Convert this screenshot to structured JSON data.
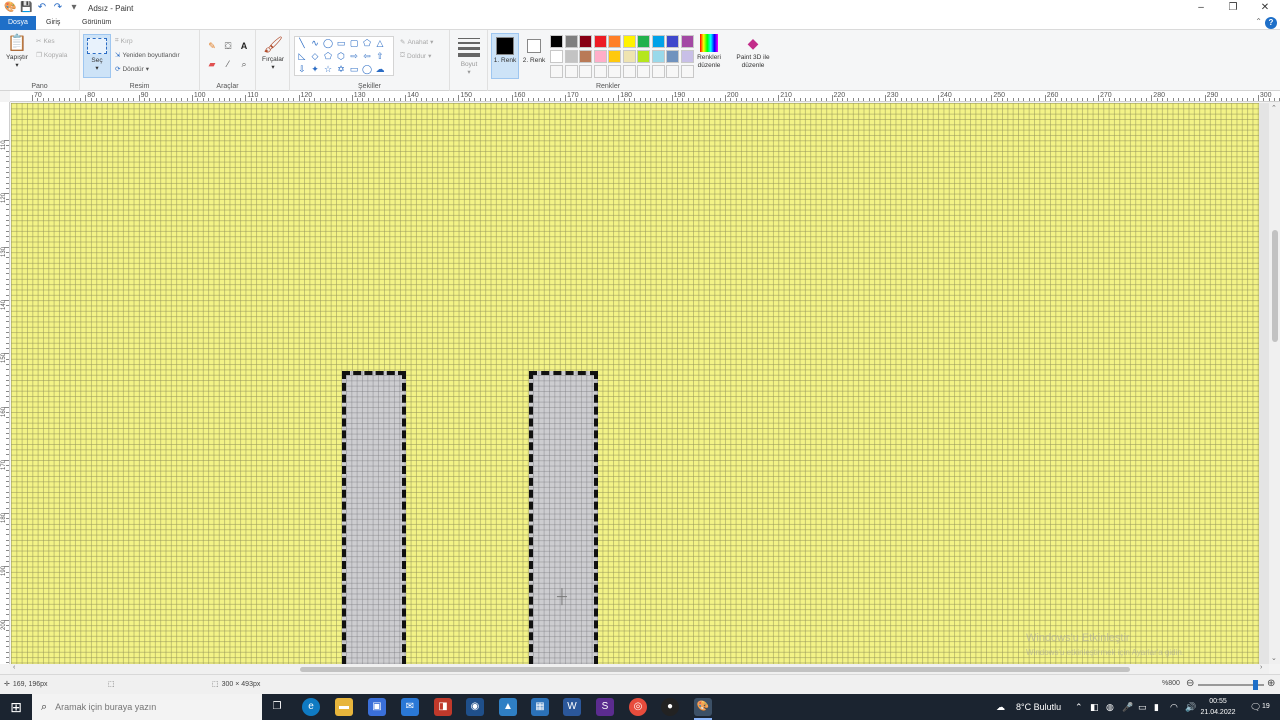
{
  "window": {
    "title": "Adsız - Paint",
    "minimize": "–",
    "maximize": "❐",
    "close": "✕"
  },
  "tabs": [
    {
      "label": "Dosya"
    },
    {
      "label": "Giriş"
    },
    {
      "label": "Görünüm"
    }
  ],
  "ribbon": {
    "clipboard": {
      "label": "Pano",
      "paste": "Yapıştır",
      "cut": "Kes",
      "copy": "Kopyala"
    },
    "image": {
      "label": "Resim",
      "select": "Seç",
      "crop": "Kırp",
      "resize": "Yeniden boyutlandır",
      "rotate": "Döndür"
    },
    "tools": {
      "label": "Araçlar"
    },
    "brushes": {
      "label": "Fırçalar"
    },
    "shapes": {
      "label": "Şekiller",
      "outline": "Anahat",
      "fill": "Doldur"
    },
    "size": {
      "label": "Boyut"
    },
    "colors": {
      "label": "Renkler",
      "color1": "1. Renk",
      "color2": "2. Renk",
      "edit_colors": "Renkleri düzenle",
      "paint3d": "Paint 3D ile düzenle",
      "color1_value": "#000000",
      "color2_value": "#ffffff",
      "palette_row1": [
        "#000000",
        "#7f7f7f",
        "#880015",
        "#ed1c24",
        "#ff7f27",
        "#fff200",
        "#22b14c",
        "#00a2e8",
        "#3f48cc",
        "#a349a4"
      ],
      "palette_row2": [
        "#ffffff",
        "#c3c3c3",
        "#b97a57",
        "#ffaec9",
        "#ffc90e",
        "#efe4b0",
        "#b5e61d",
        "#99d9ea",
        "#7092be",
        "#c8bfe7"
      ]
    }
  },
  "ruler": {
    "horizontal": [
      "70",
      "80",
      "90",
      "100",
      "110",
      "120",
      "130",
      "140",
      "150",
      "160",
      "170",
      "180",
      "190",
      "200",
      "210",
      "220",
      "230",
      "240",
      "250",
      "260",
      "270",
      "280",
      "290",
      "300"
    ],
    "vertical": [
      "110",
      "120",
      "130",
      "140",
      "150",
      "160",
      "170",
      "180",
      "190",
      "200"
    ]
  },
  "canvas": {
    "background": "#f3f387"
  },
  "watermark": {
    "title": "Windows'u Etkinleştir",
    "subtitle": "Windows'u etkinleştirmek için Ayarlar'a gidin."
  },
  "status": {
    "cursor_pos": "169, 196px",
    "canvas_size": "300 × 493px",
    "zoom": "%800"
  },
  "taskbar": {
    "search_placeholder": "Aramak için buraya yazın",
    "weather": "8°C Bulutlu",
    "time": "00:55",
    "date": "21.04.2022",
    "notifications": "19"
  }
}
